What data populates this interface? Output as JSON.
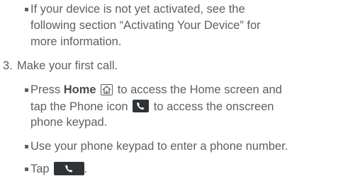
{
  "doc": {
    "bullet1": {
      "l1": "If your device is not yet activated, see the",
      "l2": "following section “Activating Your Device” for",
      "l3": "more information."
    },
    "step3": {
      "number": "3.",
      "text": "Make your first call."
    },
    "bullet2": {
      "prefix": "Press ",
      "home": "Home",
      "l1_rest": " to access the Home screen and",
      "l2_pre": "tap the Phone icon ",
      "l2_rest": " to access the onscreen",
      "l3": "phone keypad."
    },
    "bullet3": {
      "text": "Use your phone keypad to enter a phone number."
    },
    "bullet4": {
      "text": "Tap",
      "end": "."
    }
  },
  "icons": {
    "home": "home-icon",
    "phone": "phone-app-icon",
    "call": "call-button"
  },
  "colors": {
    "text": "#5d5f61",
    "icon_bg": "#2f3336",
    "phone_green": "#ffffff"
  }
}
